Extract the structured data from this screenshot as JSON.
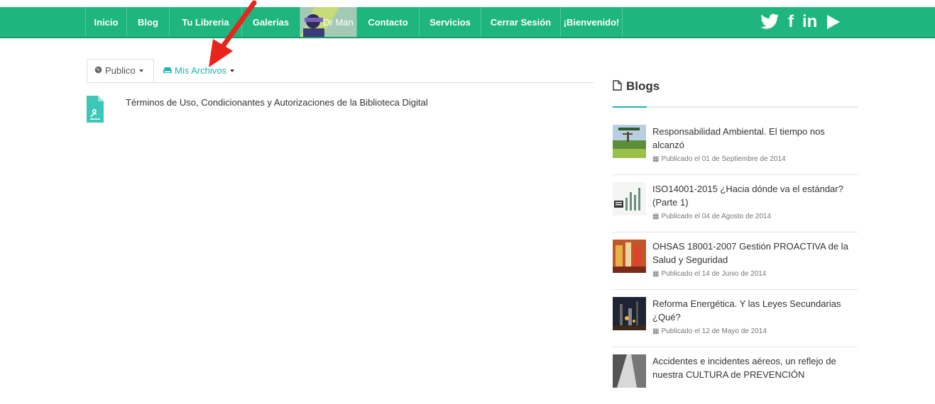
{
  "nav": {
    "items": [
      {
        "label": "Inicio"
      },
      {
        "label": "Blog"
      },
      {
        "label": "Tu Libreria"
      },
      {
        "label": "Galerias"
      }
    ],
    "avatar_label": "Dr Man",
    "items2": [
      {
        "label": "Contacto"
      },
      {
        "label": "Servicios"
      },
      {
        "label": "Cerrar Sesión"
      },
      {
        "label": "¡Bienvenido!"
      }
    ],
    "social": [
      "twitter-icon",
      "facebook-icon",
      "linkedin-icon",
      "youtube-play-icon"
    ],
    "colors": {
      "bar": "#1fb57f",
      "accent": "#1fb5b0",
      "arrow": "#e8241d"
    }
  },
  "tabs": {
    "public_label": "Publico",
    "mine_label": "Mis Archivos"
  },
  "file": {
    "title": "Términos de Uso, Condicionantes y Autorizaciones de la Biblioteca Digital"
  },
  "sidebar": {
    "heading": "Blogs",
    "posts": [
      {
        "title": "Responsabilidad Ambiental. El tiempo nos alcanzó",
        "date": "Publicado el 01 de Septiembre de 2014"
      },
      {
        "title": "ISO14001-2015 ¿Hacia dónde va el estándar? (Parte 1)",
        "date": "Publicado el 04 de Agosto de 2014"
      },
      {
        "title": "OHSAS 18001-2007 Gestión PROACTIVA de la Salud y Seguridad",
        "date": "Publicado el 14 de Junio de 2014"
      },
      {
        "title": "Reforma Energética. Y las Leyes Secundarias ¿Qué?",
        "date": "Publicado el 12 de Mayo de 2014"
      },
      {
        "title": "Accidentes e incidentes aéreos, un reflejo de nuestra CULTURA de PREVENCIÓN",
        "date": ""
      }
    ]
  }
}
